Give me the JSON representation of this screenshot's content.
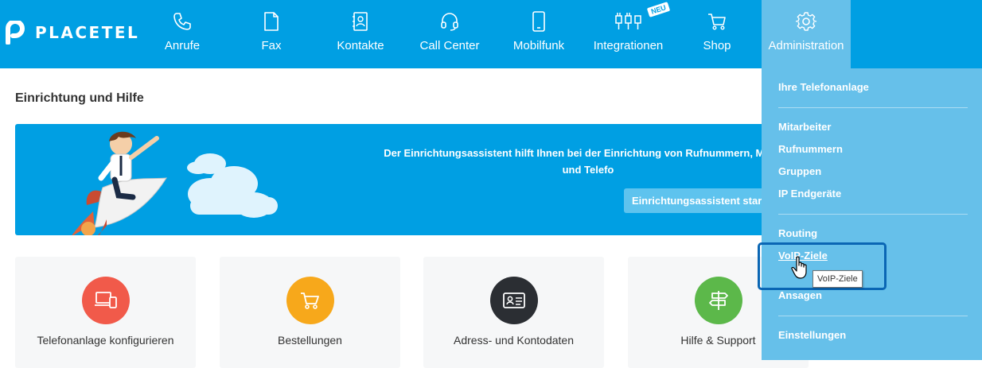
{
  "brand": {
    "name": "PLACETEL"
  },
  "nav": {
    "items": [
      {
        "label": "Anrufe",
        "icon": "phone-icon"
      },
      {
        "label": "Fax",
        "icon": "document-icon"
      },
      {
        "label": "Kontakte",
        "icon": "address-book-icon"
      },
      {
        "label": "Call Center",
        "icon": "headset-icon"
      },
      {
        "label": "Mobilfunk",
        "icon": "smartphone-icon"
      },
      {
        "label": "Integrationen",
        "icon": "plug-icon",
        "badge": "NEU"
      },
      {
        "label": "Shop",
        "icon": "cart-icon"
      },
      {
        "label": "Administration",
        "icon": "gear-icon",
        "active": true
      }
    ]
  },
  "main": {
    "title": "Einrichtung und Hilfe",
    "banner": {
      "text_line1": "Der Einrichtungsassistent hilft Ihnen bei der Einrichtung von Rufnummern, Mitarbe",
      "text_line2": "und Telefo",
      "button_label": "Einrichtungsassistent star"
    },
    "cards": [
      {
        "label": "Telefonanlage konfigurieren",
        "icon": "devices-icon",
        "color": "#f15a4a"
      },
      {
        "label": "Bestellungen",
        "icon": "cart-icon",
        "color": "#f7a81b"
      },
      {
        "label": "Adress- und Kontodaten",
        "icon": "id-card-icon",
        "color": "#2b2e33"
      },
      {
        "label": "Hilfe & Support",
        "icon": "signpost-icon",
        "color": "#5cb84a"
      }
    ]
  },
  "dropdown": {
    "items": [
      {
        "label": "Ihre Telefonanlage"
      },
      {
        "label": "Mitarbeiter"
      },
      {
        "label": "Rufnummern"
      },
      {
        "label": "Gruppen"
      },
      {
        "label": "IP Endgeräte"
      },
      {
        "label": "Routing"
      },
      {
        "label": "VoIP-Ziele",
        "hovered": true
      },
      {
        "label": "Ansagen"
      },
      {
        "label": "Einstellungen"
      }
    ],
    "tooltip": "VoIP-Ziele"
  },
  "colors": {
    "brand_blue": "#009fe3",
    "menu_blue": "#66c0ea",
    "focus_outline": "#0a66b4"
  }
}
